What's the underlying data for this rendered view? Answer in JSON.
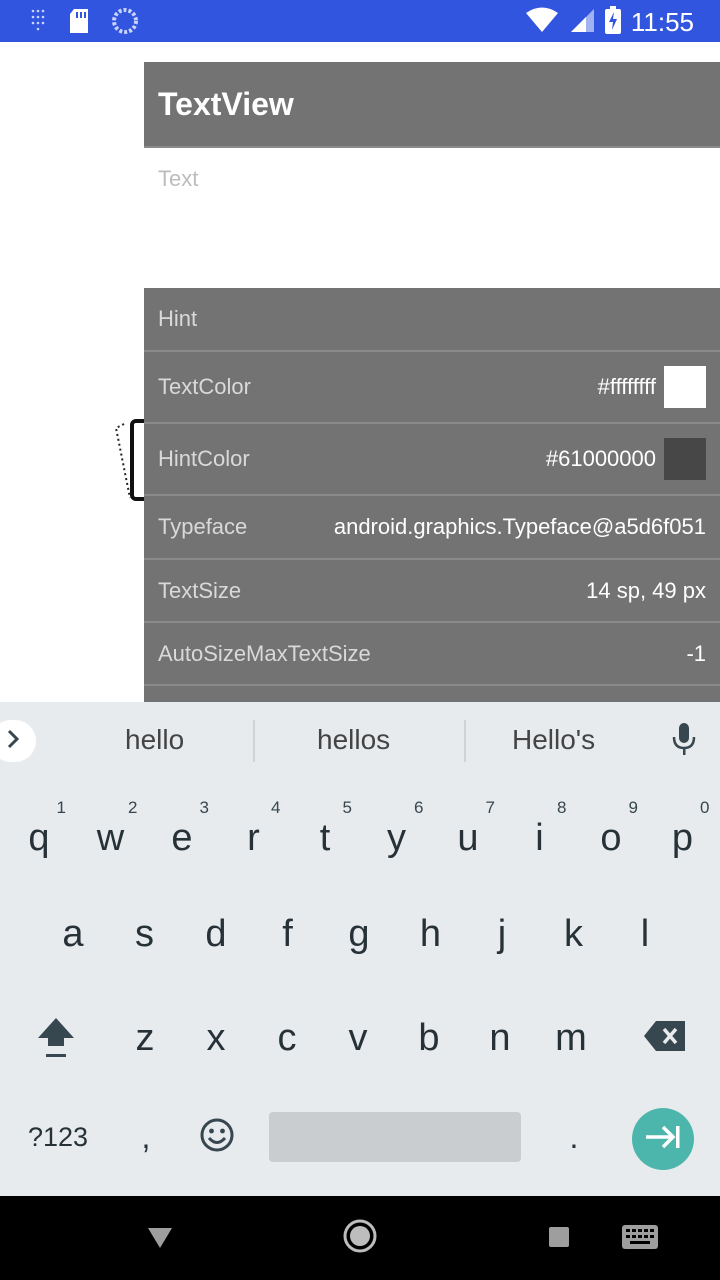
{
  "status_bar": {
    "time": "11:55",
    "icons": [
      "notification-dots-icon",
      "sd-card-icon",
      "sync-icon",
      "wifi-icon",
      "signal-icon",
      "battery-charging-icon"
    ],
    "color": "#3255e0"
  },
  "panel": {
    "title": "TextView",
    "text_placeholder": "Text",
    "properties": [
      {
        "label": "Hint",
        "value": ""
      },
      {
        "label": "TextColor",
        "value": "#ffffffff",
        "swatch": "#ffffff"
      },
      {
        "label": "HintColor",
        "value": "#61000000",
        "swatch": "#474747"
      },
      {
        "label": "Typeface",
        "value": "android.graphics.Typeface@a5d6f051"
      },
      {
        "label": "TextSize",
        "value": "14 sp, 49 px"
      },
      {
        "label": "AutoSizeMaxTextSize",
        "value": "-1"
      }
    ]
  },
  "keyboard": {
    "suggestions": [
      "hello",
      "hellos",
      "Hello's"
    ],
    "row1": [
      "q",
      "w",
      "e",
      "r",
      "t",
      "y",
      "u",
      "i",
      "o",
      "p"
    ],
    "row1_nums": [
      "1",
      "2",
      "3",
      "4",
      "5",
      "6",
      "7",
      "8",
      "9",
      "0"
    ],
    "row2": [
      "a",
      "s",
      "d",
      "f",
      "g",
      "h",
      "j",
      "k",
      "l"
    ],
    "row3": [
      "z",
      "x",
      "c",
      "v",
      "b",
      "n",
      "m"
    ],
    "symbols_key": "?123",
    "comma_key": ",",
    "period_key": ".",
    "enter_color": "#4db6ac"
  },
  "nav_bar": {
    "icons": [
      "back-icon",
      "home-icon",
      "recents-icon",
      "keyboard-switch-icon"
    ]
  }
}
